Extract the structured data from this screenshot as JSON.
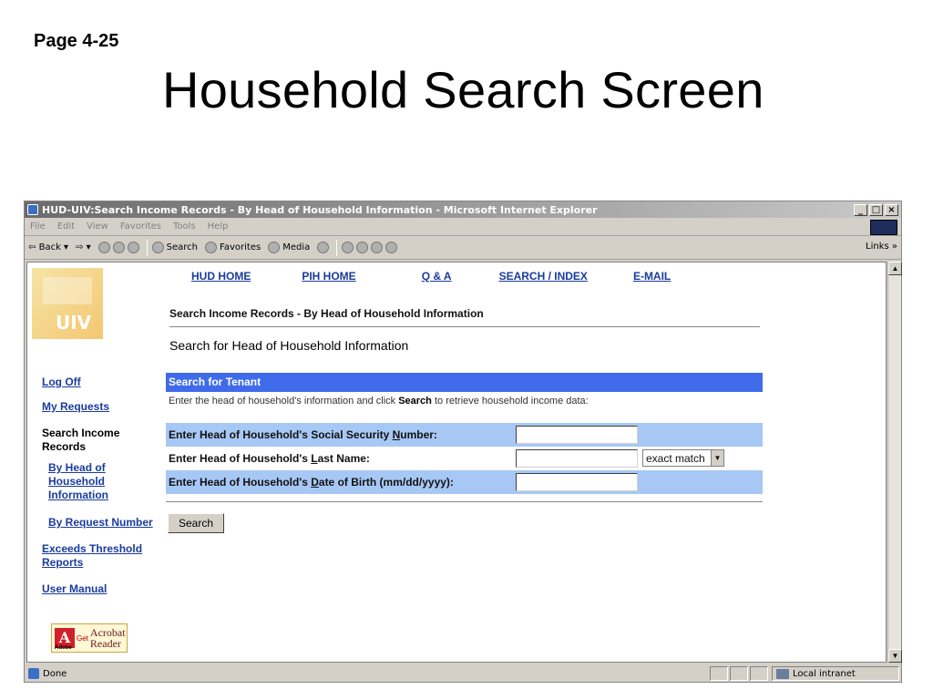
{
  "slide": {
    "page_number": "Page 4-25",
    "title": "Household Search Screen"
  },
  "window": {
    "title": "HUD-UIV:Search Income Records - By Head of Household Information - Microsoft Internet Explorer",
    "minimize": "_",
    "maximize": "□",
    "close": "×"
  },
  "menu": [
    "File",
    "Edit",
    "View",
    "Favorites",
    "Tools",
    "Help"
  ],
  "toolbar": {
    "back": "Back",
    "search": "Search",
    "favorites": "Favorites",
    "media": "Media",
    "links": "Links »"
  },
  "status": {
    "left": "Done",
    "zone": "Local intranet"
  },
  "page": {
    "logo_text": "UIV",
    "topnav": [
      "HUD HOME",
      "PIH HOME",
      "Q & A",
      "SEARCH / INDEX",
      "E-MAIL"
    ],
    "breadcrumb": "Search Income Records - By Head of Household Information",
    "subheading": "Search for Head of Household Information",
    "leftnav": {
      "log_off": "Log Off",
      "my_requests": "My Requests",
      "search_income_line1": "Search Income",
      "search_income_line2": "Records",
      "by_head_line1": "By Head of",
      "by_head_line2": "Household",
      "by_head_line3": "Information",
      "by_request": "By Request Number",
      "exceeds_line1": "Exceeds Threshold",
      "exceeds_line2": "Reports",
      "user_manual": "User Manual"
    },
    "acrobat": {
      "get": "Get",
      "line1": "Acrobat",
      "line2": "Reader",
      "adobe": "Adobe"
    },
    "form": {
      "panel_title": "Search for Tenant",
      "desc_before": "Enter the head of household's information and click ",
      "desc_bold": "Search",
      "desc_after": " to retrieve household income data:",
      "ssn": {
        "pre": "Enter Head of Household's Social Security ",
        "u": "N",
        "post": "umber:",
        "value": ""
      },
      "last_name": {
        "pre": "Enter Head of Household's ",
        "u": "L",
        "post": "ast Name:",
        "value": ""
      },
      "match_select": "exact match",
      "dob": {
        "pre": "Enter Head of Household's ",
        "u": "D",
        "post": "ate of Birth (mm/dd/yyyy):",
        "value": ""
      },
      "search_button": "Search"
    }
  }
}
